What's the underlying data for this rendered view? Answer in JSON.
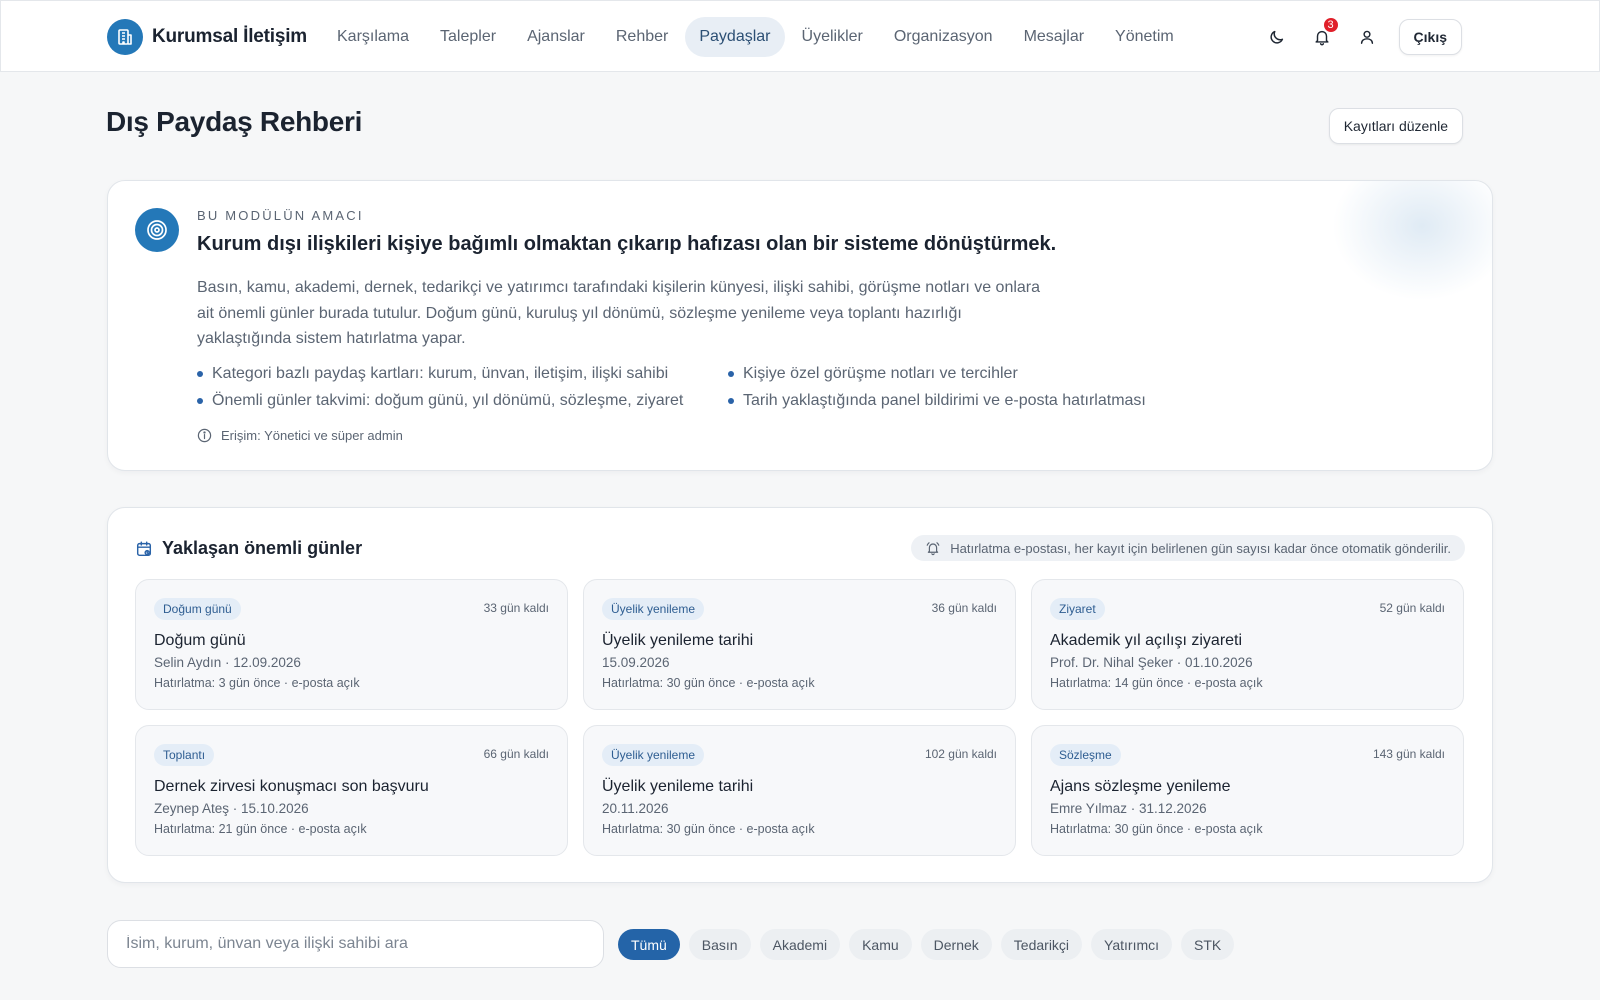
{
  "app": {
    "brand_name": "Kurumsal İletişim",
    "brand_icon": "building-icon"
  },
  "nav": {
    "items": [
      {
        "label": "Karşılama",
        "active": false
      },
      {
        "label": "Talepler",
        "active": false
      },
      {
        "label": "Ajanslar",
        "active": false
      },
      {
        "label": "Rehber",
        "active": false
      },
      {
        "label": "Paydaşlar",
        "active": true
      },
      {
        "label": "Üyelikler",
        "active": false
      },
      {
        "label": "Organizasyon",
        "active": false
      },
      {
        "label": "Mesajlar",
        "active": false
      },
      {
        "label": "Yönetim",
        "active": false
      }
    ]
  },
  "topbar": {
    "notification_count": "3",
    "logout_label": "Çıkış"
  },
  "page": {
    "title": "Dış Paydaş Rehberi",
    "edit_label": "Kayıtları düzenle"
  },
  "purpose": {
    "kicker": "BU MODÜLÜN AMACI",
    "title": "Kurum dışı ilişkileri kişiye bağımlı olmaktan çıkarıp hafızası olan bir sisteme dönüştürmek.",
    "description": "Basın, kamu, akademi, dernek, tedarikçi ve yatırımcı tarafındaki kişilerin künyesi, ilişki sahibi, görüşme notları ve onlara ait önemli günler burada tutulur. Doğum günü, kuruluş yıl dönümü, sözleşme yenileme veya toplantı hazırlığı yaklaştığında sistem hatırlatma yapar.",
    "bullets": [
      "Kategori bazlı paydaş kartları: kurum, ünvan, iletişim, ilişki sahibi",
      "Kişiye özel görüşme notları ve tercihler",
      "Önemli günler takvimi: doğum günü, yıl dönümü, sözleşme, ziyaret",
      "Tarih yaklaştığında panel bildirimi ve e-posta hatırlatması"
    ],
    "access": "Erişim: Yönetici ve süper admin"
  },
  "upcoming": {
    "title": "Yaklaşan önemli günler",
    "note": "Hatırlatma e-postası, her kayıt için belirlenen gün sayısı kadar önce otomatik gönderilir.",
    "events": [
      {
        "tag": "Doğum günü",
        "days": "33 gün kaldı",
        "title": "Doğum günü",
        "sub": "Selin Aydın · 12.09.2026",
        "remind": "Hatırlatma: 3 gün önce · e-posta açık"
      },
      {
        "tag": "Üyelik yenileme",
        "days": "36 gün kaldı",
        "title": "Üyelik yenileme tarihi",
        "sub": "15.09.2026",
        "remind": "Hatırlatma: 30 gün önce · e-posta açık"
      },
      {
        "tag": "Ziyaret",
        "days": "52 gün kaldı",
        "title": "Akademik yıl açılışı ziyareti",
        "sub": "Prof. Dr. Nihal Şeker · 01.10.2026",
        "remind": "Hatırlatma: 14 gün önce · e-posta açık"
      },
      {
        "tag": "Toplantı",
        "days": "66 gün kaldı",
        "title": "Dernek zirvesi konuşmacı son başvuru",
        "sub": "Zeynep Ateş · 15.10.2026",
        "remind": "Hatırlatma: 21 gün önce · e-posta açık"
      },
      {
        "tag": "Üyelik yenileme",
        "days": "102 gün kaldı",
        "title": "Üyelik yenileme tarihi",
        "sub": "20.11.2026",
        "remind": "Hatırlatma: 30 gün önce · e-posta açık"
      },
      {
        "tag": "Sözleşme",
        "days": "143 gün kaldı",
        "title": "Ajans sözleşme yenileme",
        "sub": "Emre Yılmaz · 31.12.2026",
        "remind": "Hatırlatma: 30 gün önce · e-posta açık"
      }
    ]
  },
  "search": {
    "placeholder": "İsim, kurum, ünvan veya ilişki sahibi ara",
    "value": ""
  },
  "filters": {
    "items": [
      {
        "label": "Tümü",
        "active": true
      },
      {
        "label": "Basın",
        "active": false
      },
      {
        "label": "Akademi",
        "active": false
      },
      {
        "label": "Kamu",
        "active": false
      },
      {
        "label": "Dernek",
        "active": false
      },
      {
        "label": "Tedarikçi",
        "active": false
      },
      {
        "label": "Yatırımcı",
        "active": false
      },
      {
        "label": "STK",
        "active": false
      }
    ]
  },
  "colors": {
    "accent": "#2478b8",
    "active_chip": "#2464a8",
    "badge": "#e0202a"
  }
}
